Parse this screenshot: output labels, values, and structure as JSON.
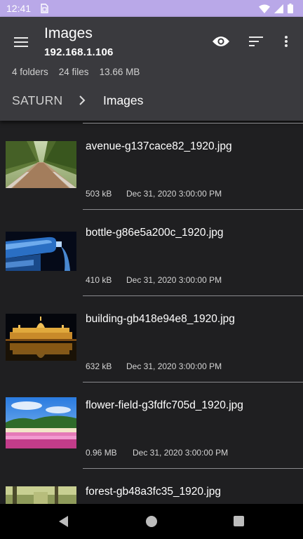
{
  "status_bar": {
    "time": "12:41",
    "icons": [
      "sim-card-icon",
      "wifi-icon",
      "signal-icon",
      "battery-icon"
    ]
  },
  "app_bar": {
    "title": "Images",
    "subtitle": "192.168.1.106",
    "actions": [
      "eye-icon",
      "sort-icon",
      "more-vert-icon"
    ]
  },
  "summary": {
    "folders": "4 folders",
    "files": "24 files",
    "size": "13.66 MB"
  },
  "breadcrumb": {
    "root": "SATURN",
    "current": "Images"
  },
  "files": [
    {
      "name": "avenue-g137cace82_1920.jpg",
      "size": "503 kB",
      "date": "Dec 31, 2020 3:00:00 PM"
    },
    {
      "name": "bottle-g86e5a200c_1920.jpg",
      "size": "410 kB",
      "date": "Dec 31, 2020 3:00:00 PM"
    },
    {
      "name": "building-gb418e94e8_1920.jpg",
      "size": "632 kB",
      "date": "Dec 31, 2020 3:00:00 PM"
    },
    {
      "name": "flower-field-g3fdfc705d_1920.jpg",
      "size": "0.96 MB",
      "date": "Dec 31, 2020 3:00:00 PM"
    },
    {
      "name": "forest-gb48a3fc35_1920.jpg"
    }
  ],
  "nav_bar": {
    "buttons": [
      "back-icon",
      "home-icon",
      "recents-icon"
    ]
  },
  "colors": {
    "status_bar": "#b9a8e8",
    "app_bar": "#3a3a3e",
    "background": "#1f1f21",
    "divider": "#8a8a8e"
  }
}
